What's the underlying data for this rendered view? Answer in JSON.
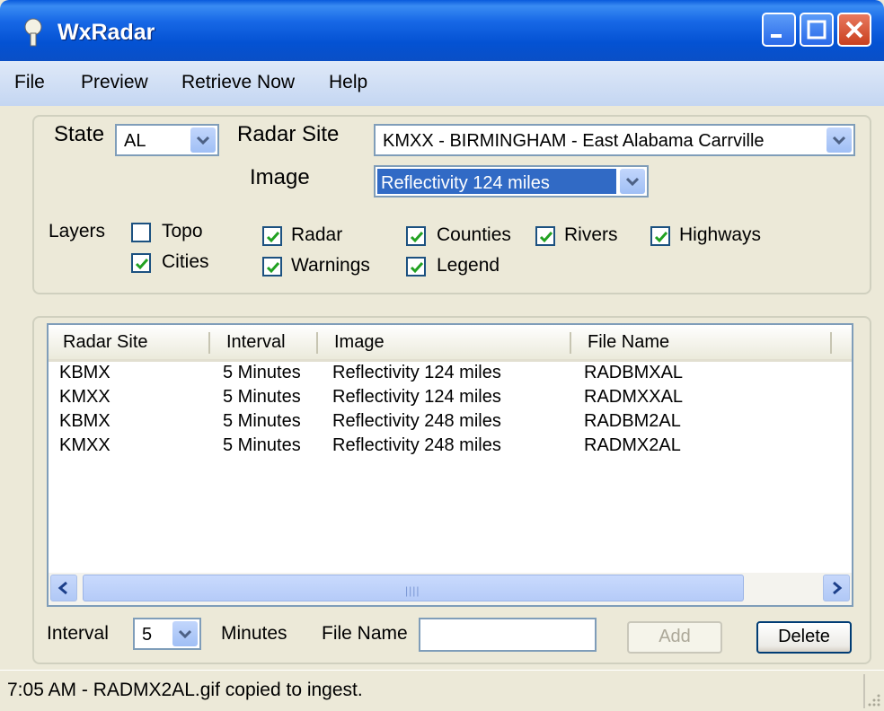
{
  "window": {
    "title": "WxRadar"
  },
  "menu": [
    "File",
    "Preview",
    "Retrieve Now",
    "Help"
  ],
  "settings": {
    "state_label": "State",
    "state_value": "AL",
    "radar_site_label": "Radar Site",
    "radar_site_value": "KMXX - BIRMINGHAM - East Alabama Carrville",
    "image_label": "Image",
    "image_value": "Reflectivity 124 miles",
    "layers_label": "Layers",
    "layers": [
      {
        "label": "Topo",
        "checked": false
      },
      {
        "label": "Cities",
        "checked": true
      },
      {
        "label": "Radar",
        "checked": true
      },
      {
        "label": "Warnings",
        "checked": true
      },
      {
        "label": "Counties",
        "checked": true
      },
      {
        "label": "Legend",
        "checked": true
      },
      {
        "label": "Rivers",
        "checked": true
      },
      {
        "label": "Highways",
        "checked": true
      }
    ]
  },
  "table": {
    "columns": [
      "Radar Site",
      "Interval",
      "Image",
      "File Name"
    ],
    "rows": [
      [
        "KBMX",
        "5 Minutes",
        "Reflectivity 124 miles",
        "RADBMXAL"
      ],
      [
        "KMXX",
        "5 Minutes",
        "Reflectivity 124 miles",
        "RADMXXAL"
      ],
      [
        "KBMX",
        "5 Minutes",
        "Reflectivity 248 miles",
        "RADBM2AL"
      ],
      [
        "KMXX",
        "5 Minutes",
        "Reflectivity 248 miles",
        "RADMX2AL"
      ]
    ]
  },
  "controls": {
    "interval_label": "Interval",
    "interval_value": "5",
    "minutes_label": "Minutes",
    "file_name_label": "File Name",
    "file_name_value": "",
    "add_label": "Add",
    "delete_label": "Delete"
  },
  "status": {
    "text": "7:05 AM - RADMX2AL.gif copied to ingest."
  },
  "colors": {
    "titlebar": "#0a5bdc",
    "selection": "#316ac5",
    "face": "#ece9d8"
  }
}
